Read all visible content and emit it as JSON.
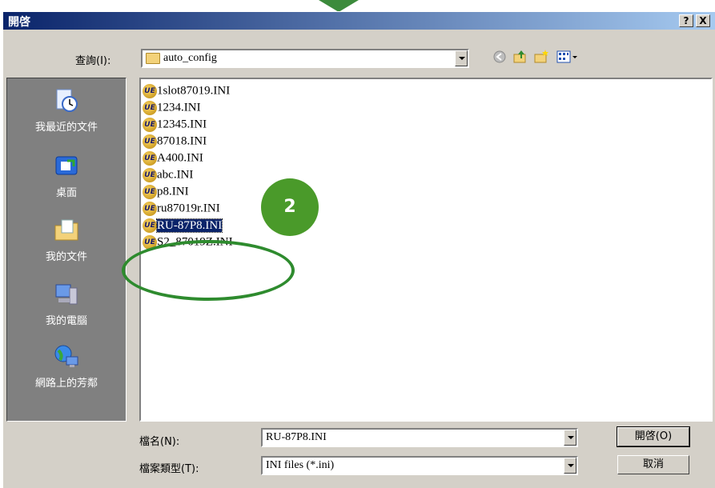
{
  "dialog": {
    "title": "開啓",
    "help_btn": "?",
    "close_btn": "X"
  },
  "lookin": {
    "label": "查詢(I):",
    "value": "auto_config"
  },
  "places": [
    {
      "label": "我最近的文件",
      "icon": "recent-documents-icon"
    },
    {
      "label": "桌面",
      "icon": "desktop-icon"
    },
    {
      "label": "我的文件",
      "icon": "my-documents-icon"
    },
    {
      "label": "我的電腦",
      "icon": "my-computer-icon"
    },
    {
      "label": "網路上的芳鄰",
      "icon": "network-places-icon"
    }
  ],
  "files": [
    "1slot87019.INI",
    "1234.INI",
    "12345.INI",
    "87018.INI",
    "A400.INI",
    "abc.INI",
    "p8.INI",
    "ru87019r.INI",
    "RU-87P8.INI",
    "S2_87019Z.INI"
  ],
  "selected_file": "RU-87P8.INI",
  "annotation": {
    "badge": "2",
    "color": "#2e8b2e"
  },
  "filename": {
    "label": "檔名(N):",
    "value": "RU-87P8.INI"
  },
  "filetype": {
    "label": "檔案類型(T):",
    "value": "INI files (*.ini)"
  },
  "buttons": {
    "open": "開啓(O)",
    "cancel": "取消"
  }
}
